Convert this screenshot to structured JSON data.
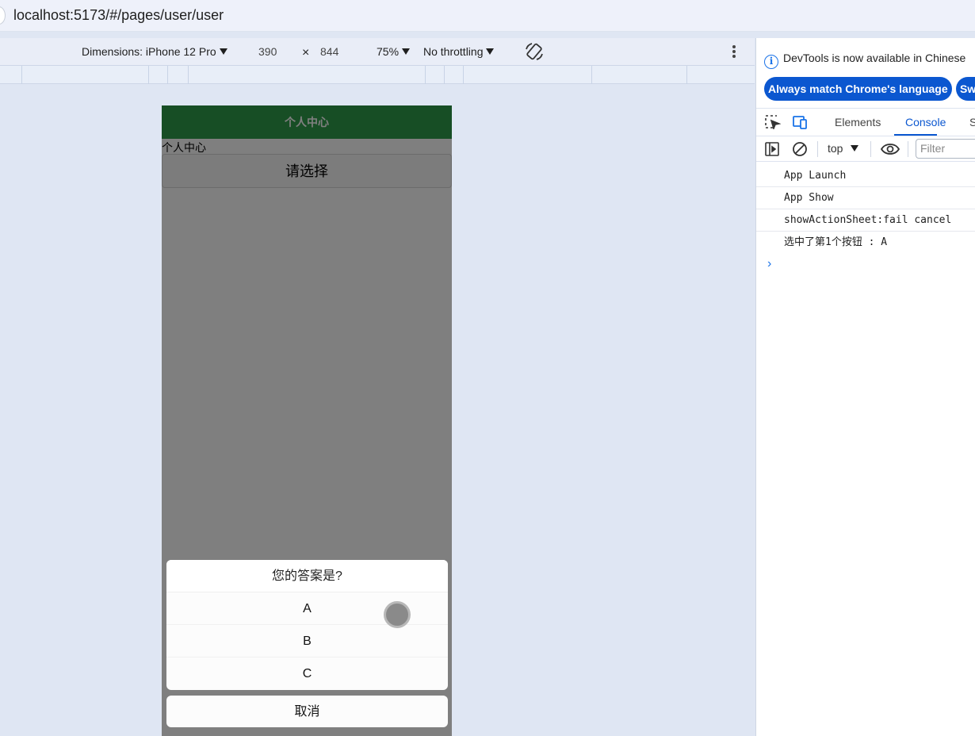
{
  "browser": {
    "url": "localhost:5173/#/pages/user/user"
  },
  "device_toolbar": {
    "dimensions_label": "Dimensions: iPhone 12 Pro",
    "width": "390",
    "times": "×",
    "height": "844",
    "zoom": "75%",
    "throttling": "No throttling"
  },
  "app": {
    "nav_title": "个人中心",
    "page_text": "个人中心",
    "select_button": "请选择",
    "nav_color": "#2e9d4a",
    "action_sheet": {
      "title": "您的答案是?",
      "items": [
        "A",
        "B",
        "C"
      ],
      "cancel": "取消"
    }
  },
  "devtools": {
    "info_text": "DevTools is now available in Chinese",
    "match_language_button": "Always match Chrome's language",
    "switch_button": "Sw",
    "tabs": [
      "Elements",
      "Console",
      "S"
    ],
    "active_tab": "Console",
    "context": "top",
    "filter_placeholder": "Filter",
    "console_lines": [
      "App Launch",
      "App Show",
      "showActionSheet:fail cancel",
      "选中了第1个按钮 : A"
    ],
    "prompt": "›",
    "accent": "#0b57d0"
  }
}
